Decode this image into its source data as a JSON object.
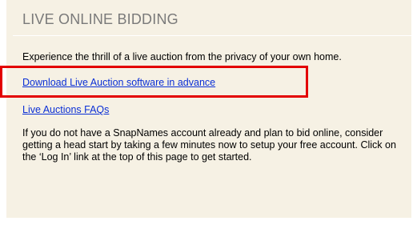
{
  "panel": {
    "title": "LIVE ONLINE BIDDING",
    "intro": "Experience the thrill of a live auction from the privacy of your own home.",
    "links": {
      "download": "Download Live Auction software in advance",
      "faq": "Live Auctions FAQs"
    },
    "body_text": "If you do not have a SnapNames account already and plan to bid online, consider getting a head start by taking a few minutes now to setup your free account.  Click on the ‘Log In’ link at the top of this page to get started."
  },
  "colors": {
    "panel_background": "#f6f1e4",
    "title_text": "#7a7a7a",
    "link": "#0a2fd6",
    "highlight_box": "#e30000"
  }
}
